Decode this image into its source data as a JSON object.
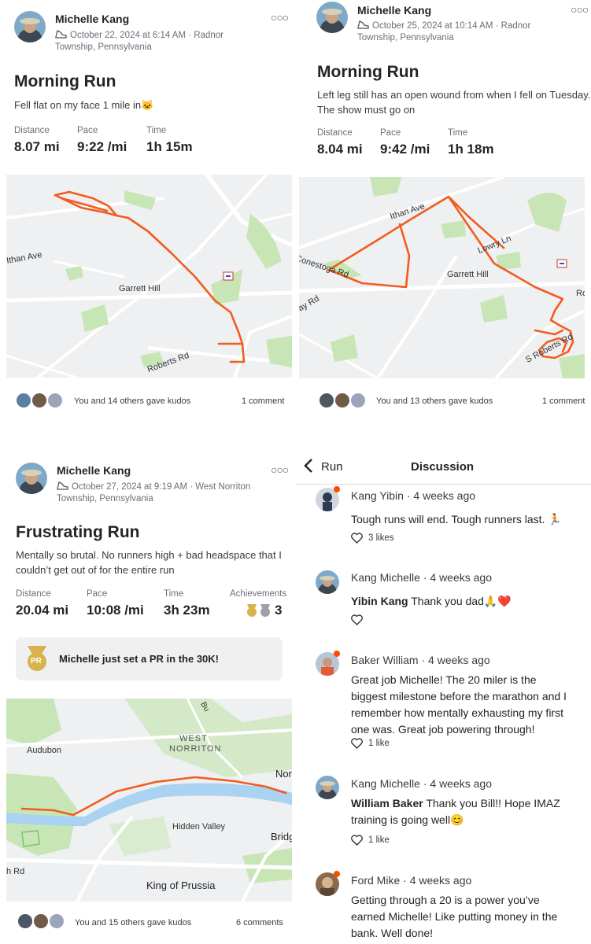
{
  "activities": [
    {
      "athlete": "Michelle Kang",
      "date": "October 22, 2024 at 6:14 AM · Radnor",
      "location": "Township, Pennsylvania",
      "title": "Morning Run",
      "description": "Fell flat on my face 1 mile in🐱",
      "stats": [
        {
          "label": "Distance",
          "value": "8.07 mi"
        },
        {
          "label": "Pace",
          "value": "9:22 /mi"
        },
        {
          "label": "Time",
          "value": "1h 15m"
        }
      ],
      "map_labels": {
        "road1": "Ithan Ave",
        "place": "Garrett Hill",
        "road2": "Roberts Rd"
      },
      "kudos": "You and 14 others gave kudos",
      "comments": "1 comment"
    },
    {
      "athlete": "Michelle Kang",
      "date": "October 25, 2024 at 10:14 AM · Radnor",
      "location": "Township, Pennsylvania",
      "title": "Morning Run",
      "description_line1": "Left leg still has an open wound from when I fell on Tuesday.",
      "description_line2": "The show must go on",
      "stats": [
        {
          "label": "Distance",
          "value": "8.04 mi"
        },
        {
          "label": "Pace",
          "value": "9:42 /mi"
        },
        {
          "label": "Time",
          "value": "1h 18m"
        }
      ],
      "map_labels": {
        "road1": "Ithan Ave",
        "road2": "Lowry Ln",
        "road3": "Conestoga Rd",
        "road4": "ay Rd",
        "place": "Garrett Hill",
        "road5": "S Roberts Rd",
        "road6": "Ro"
      },
      "kudos": "You and 13 others gave kudos",
      "comments": "1 comment"
    },
    {
      "athlete": "Michelle Kang",
      "date": "October 27, 2024 at 9:19 AM · West Norriton",
      "location": "Township, Pennsylvania",
      "title": "Frustrating Run",
      "description_line1": "Mentally so brutal. No runners high + bad headspace that I",
      "description_line2": "couldn’t get out of for the entire run",
      "stats": [
        {
          "label": "Distance",
          "value": "20.04 mi"
        },
        {
          "label": "Pace",
          "value": "10:08 /mi"
        },
        {
          "label": "Time",
          "value": "3h 23m"
        },
        {
          "label": "Achievements",
          "value": "3"
        }
      ],
      "pr_text": "Michelle just set a PR in the 30K!",
      "pr_badge": "PR",
      "map_labels": {
        "area1": "WEST",
        "area2": "NORRITON",
        "town1": "Audubon",
        "place": "Hidden Valley",
        "town2": "King of Prussia",
        "town3": "Nor",
        "town4": "Bridg",
        "road": "h Rd",
        "road2": "Bu"
      },
      "kudos": "You and 15 others gave kudos",
      "comments": "6 comments"
    }
  ],
  "discussion": {
    "back_label": "Run",
    "title": "Discussion",
    "comments": [
      {
        "name": "Kang Yibin",
        "time": "4 weeks ago",
        "body": "Tough runs will end. Tough runners last. 🏃",
        "likes": "3 likes"
      },
      {
        "name": "Kang Michelle",
        "time": "4 weeks ago",
        "mention": "Yibin Kang",
        "body": " Thank you dad🙏❤️",
        "likes": ""
      },
      {
        "name": "Baker William",
        "time": "4 weeks ago",
        "body_lines": [
          "Great job Michelle! The 20 miler is the",
          "biggest milestone before the marathon and I",
          "remember how mentally exhausting my first",
          "one was. Great job powering through!"
        ],
        "likes": "1 like"
      },
      {
        "name": "Kang Michelle",
        "time": "4 weeks ago",
        "mention": "William Baker",
        "body": " Thank you Bill!! Hope IMAZ",
        "body_line2": "training is going well😊",
        "likes": "1 like"
      },
      {
        "name": "Ford Mike",
        "time": "4 weeks ago",
        "body_lines": [
          "Getting through a 20 is a power you’ve",
          "earned Michelle!  Like putting money in the",
          "bank. Well done!"
        ]
      }
    ]
  },
  "colors": {
    "route": "#f25c1f",
    "accent": "#fc4c02",
    "map_bg": "#eef0f2",
    "park": "#c8e6b5",
    "water": "#a9d3f0"
  },
  "icons": [
    "shoe-icon",
    "more-icon",
    "heart-icon",
    "chevron-left-icon",
    "medal-icon"
  ]
}
